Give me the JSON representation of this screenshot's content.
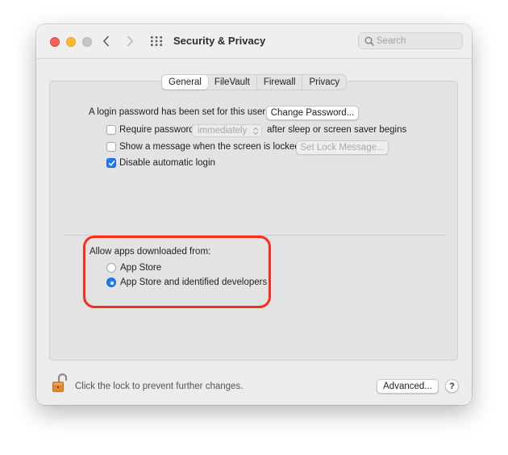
{
  "window": {
    "title": "Security & Privacy"
  },
  "toolbar": {
    "back_icon": "chevron-left-icon",
    "forward_icon": "chevron-right-icon",
    "show_all_icon": "grid-icon"
  },
  "search": {
    "placeholder": "Search",
    "value": ""
  },
  "tabs": [
    {
      "label": "General",
      "selected": true
    },
    {
      "label": "FileVault",
      "selected": false
    },
    {
      "label": "Firewall",
      "selected": false
    },
    {
      "label": "Privacy",
      "selected": false
    }
  ],
  "general": {
    "login_password_text": "A login password has been set for this user",
    "change_password_button": "Change Password...",
    "require_password": {
      "label": "Require password",
      "checked": false,
      "popup_value": "immediately",
      "suffix": "after sleep or screen saver begins"
    },
    "show_message": {
      "label": "Show a message when the screen is locked",
      "checked": false,
      "button": "Set Lock Message..."
    },
    "disable_auto_login": {
      "label": "Disable automatic login",
      "checked": true
    }
  },
  "allow_apps": {
    "heading": "Allow apps downloaded from:",
    "options": [
      {
        "label": "App Store",
        "selected": false
      },
      {
        "label": "App Store and identified developers",
        "selected": true
      }
    ],
    "highlight_color": "#ff2b1c"
  },
  "footer": {
    "lock_text": "Click the lock to prevent further changes.",
    "lock_icon": "unlocked-padlock-icon",
    "advanced_button": "Advanced...",
    "help_button": "?"
  },
  "colors": {
    "accent": "#1f7cf5",
    "close": "#fe5f57",
    "minimize": "#febc2e",
    "zoom": "#c7c7c7"
  }
}
